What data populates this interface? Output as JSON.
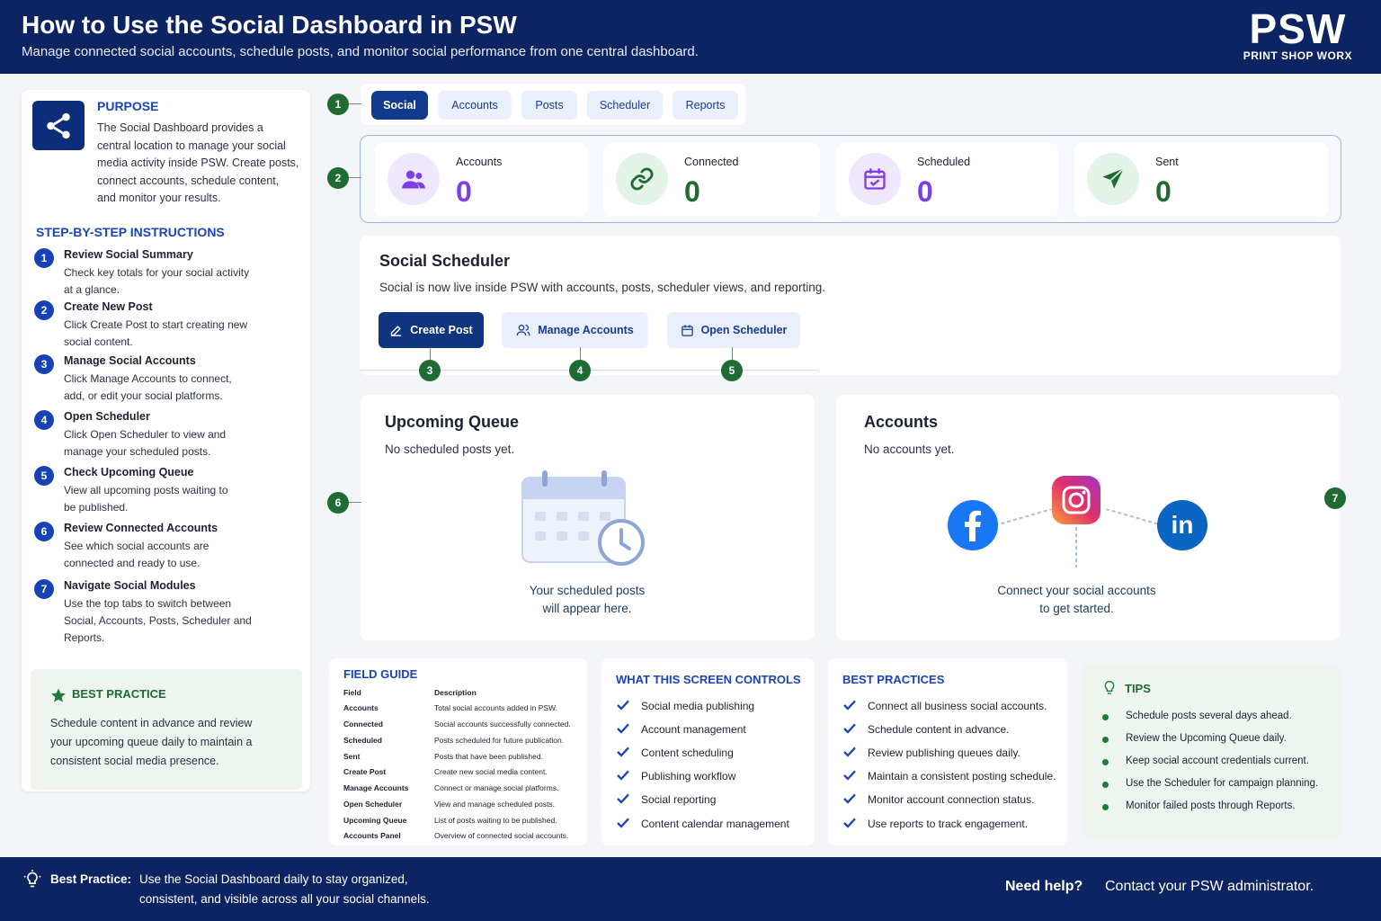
{
  "header": {
    "title": "How to Use the Social Dashboard in PSW",
    "subtitle": "Manage connected social accounts, schedule posts, and monitor social performance from one central dashboard.",
    "logo_mark": "PSW",
    "logo_sub": "PRINT SHOP WORX"
  },
  "purpose": {
    "title": "PURPOSE",
    "text": "The Social Dashboard provides a central location to manage your social media activity inside PSW. Create posts, connect accounts, schedule content, and monitor your results."
  },
  "steps_title": "STEP-BY-STEP INSTRUCTIONS",
  "steps": [
    {
      "num": "1",
      "title": "Review Social Summary",
      "desc": "Check key totals for your social activity at a glance."
    },
    {
      "num": "2",
      "title": "Create New Post",
      "desc": "Click Create Post to start creating new social content."
    },
    {
      "num": "3",
      "title": "Manage Social Accounts",
      "desc": "Click Manage Accounts to connect, add, or edit your social platforms."
    },
    {
      "num": "4",
      "title": "Open Scheduler",
      "desc": "Click Open Scheduler to view and manage your scheduled posts."
    },
    {
      "num": "5",
      "title": "Check Upcoming Queue",
      "desc": "View all upcoming posts waiting to be published."
    },
    {
      "num": "6",
      "title": "Review Connected Accounts",
      "desc": "See which social accounts are connected and ready to use."
    },
    {
      "num": "7",
      "title": "Navigate Social Modules",
      "desc": "Use the top tabs to switch between Social, Accounts, Posts, Scheduler and Reports."
    }
  ],
  "best_practice_box": {
    "title": "BEST PRACTICE",
    "text": "Schedule content in advance and review your upcoming queue daily to maintain a consistent social media presence."
  },
  "callouts": [
    "1",
    "2",
    "3",
    "4",
    "5",
    "6",
    "7"
  ],
  "tabs": [
    {
      "label": "Social",
      "active": true
    },
    {
      "label": "Accounts",
      "active": false
    },
    {
      "label": "Posts",
      "active": false
    },
    {
      "label": "Scheduler",
      "active": false
    },
    {
      "label": "Reports",
      "active": false
    }
  ],
  "stats": [
    {
      "label": "Accounts",
      "value": "0",
      "icon": "users-icon",
      "color": "#7b3fe4"
    },
    {
      "label": "Connected",
      "value": "0",
      "icon": "link-icon",
      "color": "#1f6b33"
    },
    {
      "label": "Scheduled",
      "value": "0",
      "icon": "calendar-icon",
      "color": "#7b3fe4"
    },
    {
      "label": "Sent",
      "value": "0",
      "icon": "send-icon",
      "color": "#1f6b33"
    }
  ],
  "scheduler": {
    "title": "Social Scheduler",
    "desc": "Social is now live inside PSW with accounts, posts, scheduler views, and reporting.",
    "buttons": {
      "create_post": "Create Post",
      "manage_accounts": "Manage Accounts",
      "open_scheduler": "Open Scheduler"
    }
  },
  "queue": {
    "title": "Upcoming Queue",
    "empty": "No scheduled posts yet.",
    "caption_1": "Your scheduled posts",
    "caption_2": "will appear here."
  },
  "accounts_panel": {
    "title": "Accounts",
    "empty": "No accounts yet.",
    "caption_1": "Connect your social accounts",
    "caption_2": "to get started.",
    "linkedin_text": "in"
  },
  "field_guide": {
    "title": "FIELD GUIDE",
    "col_field": "Field",
    "col_desc": "Description",
    "rows": [
      {
        "field": "Accounts",
        "desc": "Total social accounts added in PSW."
      },
      {
        "field": "Connected",
        "desc": "Social accounts successfully connected."
      },
      {
        "field": "Scheduled",
        "desc": "Posts scheduled for future publication."
      },
      {
        "field": "Sent",
        "desc": "Posts that have been published."
      },
      {
        "field": "Create Post",
        "desc": "Create new social media content."
      },
      {
        "field": "Manage Accounts",
        "desc": "Connect or manage social platforms."
      },
      {
        "field": "Open Scheduler",
        "desc": "View and manage scheduled posts."
      },
      {
        "field": "Upcoming Queue",
        "desc": "List of posts waiting to be published."
      },
      {
        "field": "Accounts Panel",
        "desc": "Overview of connected social accounts."
      }
    ]
  },
  "controls": {
    "title": "WHAT THIS SCREEN CONTROLS",
    "items": [
      "Social media publishing",
      "Account management",
      "Content scheduling",
      "Publishing workflow",
      "Social reporting",
      "Content calendar management"
    ]
  },
  "best_practices": {
    "title": "BEST PRACTICES",
    "items": [
      "Connect all business social accounts.",
      "Schedule content in advance.",
      "Review publishing queues daily.",
      "Maintain a consistent posting schedule.",
      "Monitor account connection status.",
      "Use reports to track engagement."
    ]
  },
  "tips": {
    "title": "TIPS",
    "items": [
      "Schedule posts several days ahead.",
      "Review the Upcoming Queue daily.",
      "Keep social account credentials current.",
      "Use the Scheduler for campaign planning.",
      "Monitor failed posts through Reports."
    ]
  },
  "footer": {
    "label": "Best Practice:",
    "text": "Use the Social Dashboard daily to stay organized, consistent, and visible across all your social channels.",
    "need_help": "Need help?",
    "contact": "Contact your PSW administrator."
  },
  "colors": {
    "navy": "#0c2461",
    "accent_blue": "#1a44b8",
    "green": "#1f6b33",
    "purple": "#7b3fe4"
  }
}
